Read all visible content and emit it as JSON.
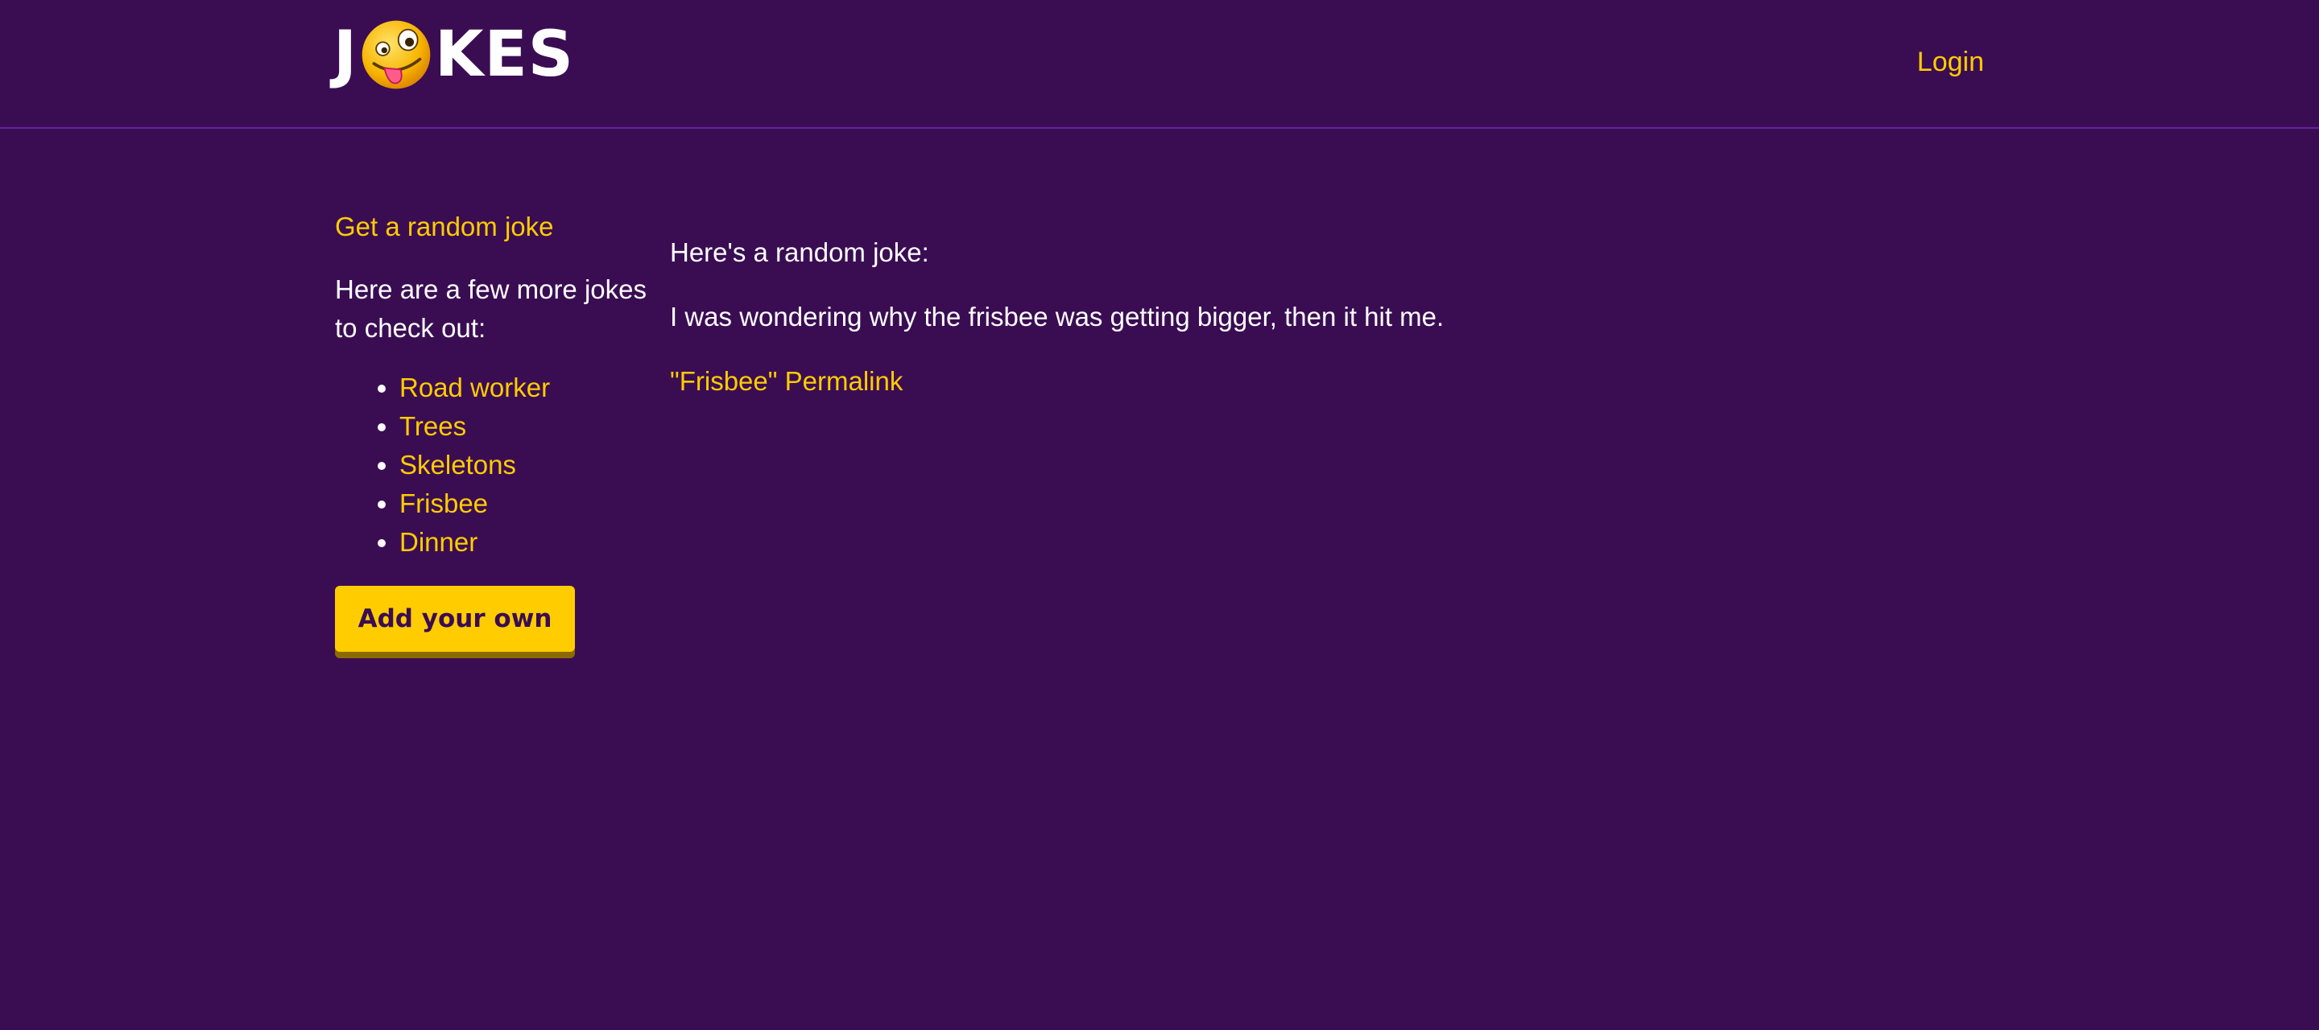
{
  "header": {
    "logo_left": "J",
    "logo_right": "KES",
    "login_label": "Login"
  },
  "sidebar": {
    "random_link": "Get a random joke",
    "more_text": "Here are a few more jokes to check out:",
    "jokes": [
      "Road worker",
      "Trees",
      "Skeletons",
      "Frisbee",
      "Dinner"
    ],
    "add_button": "Add your own"
  },
  "main": {
    "intro": "Here's a random joke:",
    "joke": "I was wondering why the frisbee was getting bigger, then it hit me.",
    "permalink": "\"Frisbee\" Permalink"
  },
  "colors": {
    "background": "#3a0d53",
    "accent": "#ffcc00",
    "text": "#ffffff"
  },
  "icons": {
    "logo_face": "zany-face-icon",
    "list_bullet": "disc"
  }
}
